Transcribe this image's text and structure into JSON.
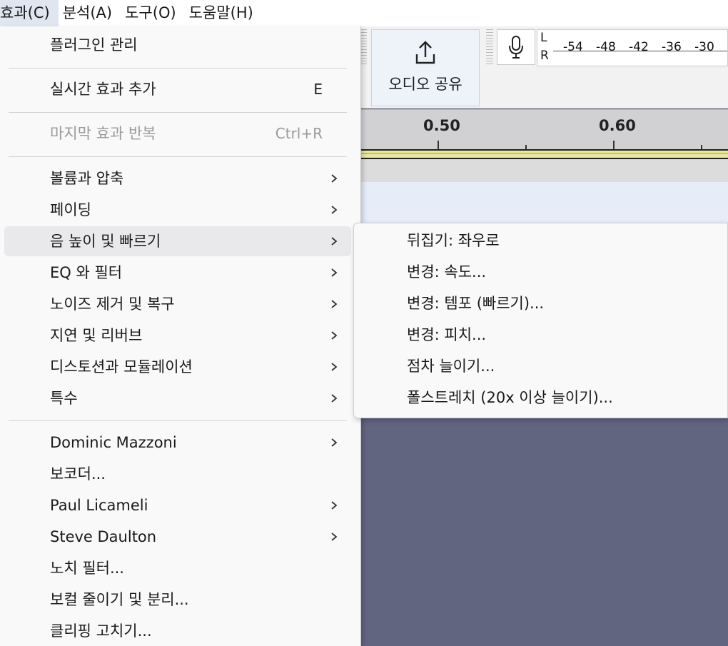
{
  "menubar": {
    "items": [
      {
        "label": "효과(C)",
        "active": true
      },
      {
        "label": "분석(A)",
        "active": false
      },
      {
        "label": "도구(O)",
        "active": false
      },
      {
        "label": "도움말(H)",
        "active": false
      }
    ]
  },
  "toolbar": {
    "share_label": "오디오 공유",
    "meter": {
      "channel_l": "L",
      "channel_r": "R",
      "ticks": [
        "-54",
        "-48",
        "-42",
        "-36",
        "-30"
      ]
    }
  },
  "timeline": {
    "ruler_labels": [
      "0.50",
      "0.60"
    ]
  },
  "effect_menu": {
    "group1": [
      {
        "label": "플러그인 관리"
      }
    ],
    "group2": [
      {
        "label": "실시간 효과 추가",
        "shortcut": "E"
      }
    ],
    "group3": [
      {
        "label": "마지막 효과 반복",
        "shortcut": "Ctrl+R",
        "disabled": true
      }
    ],
    "group4": [
      {
        "label": "볼륨과 압축",
        "submenu": true
      },
      {
        "label": "페이딩",
        "submenu": true
      },
      {
        "label": "음 높이 및 빠르기",
        "submenu": true,
        "hover": true
      },
      {
        "label": "EQ 와 필터",
        "submenu": true
      },
      {
        "label": "노이즈 제거 및 복구",
        "submenu": true
      },
      {
        "label": "지연 및 리버브",
        "submenu": true
      },
      {
        "label": "디스토션과 모듈레이션",
        "submenu": true
      },
      {
        "label": "특수",
        "submenu": true
      }
    ],
    "group5": [
      {
        "label": "Dominic Mazzoni",
        "submenu": true
      },
      {
        "label": "보코더...",
        "submenu": false
      },
      {
        "label": "Paul Licameli",
        "submenu": true
      },
      {
        "label": "Steve Daulton",
        "submenu": true
      },
      {
        "label": "노치 필터...",
        "submenu": false
      },
      {
        "label": "보컬 줄이기 및 분리...",
        "submenu": false
      },
      {
        "label": "클리핑 고치기...",
        "submenu": false
      }
    ]
  },
  "submenu": {
    "items": [
      {
        "label": "뒤집기: 좌우로"
      },
      {
        "label": "변경: 속도..."
      },
      {
        "label": "변경: 템포 (빠르기)..."
      },
      {
        "label": "변경: 피치..."
      },
      {
        "label": "점차 늘이기..."
      },
      {
        "label": "폴스트레치 (20x 이상 늘이기)..."
      }
    ]
  },
  "colors": {
    "track_background": "#62657f",
    "menu_background": "#f9f9f9",
    "hover_background": "#e9e9ec",
    "disabled_text": "#9a9a9a"
  }
}
